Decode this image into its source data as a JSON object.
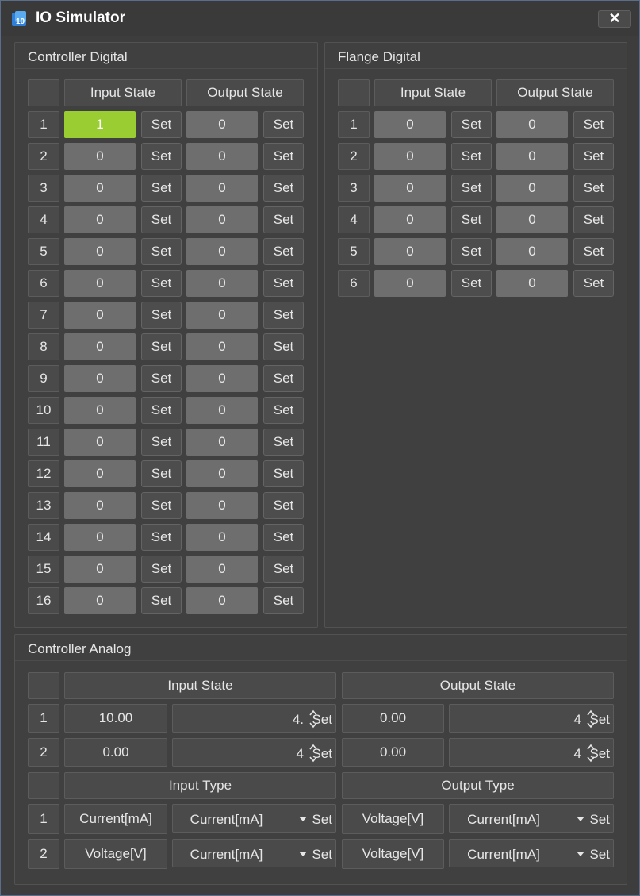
{
  "window": {
    "title": "IO Simulator",
    "close_label": "✕"
  },
  "controller_digital": {
    "title": "Controller Digital",
    "headers": {
      "input": "Input State",
      "output": "Output State"
    },
    "set_label": "Set",
    "rows": [
      {
        "idx": "1",
        "input": "1",
        "output": "0"
      },
      {
        "idx": "2",
        "input": "0",
        "output": "0"
      },
      {
        "idx": "3",
        "input": "0",
        "output": "0"
      },
      {
        "idx": "4",
        "input": "0",
        "output": "0"
      },
      {
        "idx": "5",
        "input": "0",
        "output": "0"
      },
      {
        "idx": "6",
        "input": "0",
        "output": "0"
      },
      {
        "idx": "7",
        "input": "0",
        "output": "0"
      },
      {
        "idx": "8",
        "input": "0",
        "output": "0"
      },
      {
        "idx": "9",
        "input": "0",
        "output": "0"
      },
      {
        "idx": "10",
        "input": "0",
        "output": "0"
      },
      {
        "idx": "11",
        "input": "0",
        "output": "0"
      },
      {
        "idx": "12",
        "input": "0",
        "output": "0"
      },
      {
        "idx": "13",
        "input": "0",
        "output": "0"
      },
      {
        "idx": "14",
        "input": "0",
        "output": "0"
      },
      {
        "idx": "15",
        "input": "0",
        "output": "0"
      },
      {
        "idx": "16",
        "input": "0",
        "output": "0"
      }
    ]
  },
  "flange_digital": {
    "title": "Flange Digital",
    "headers": {
      "input": "Input State",
      "output": "Output State"
    },
    "set_label": "Set",
    "rows": [
      {
        "idx": "1",
        "input": "0",
        "output": "0"
      },
      {
        "idx": "2",
        "input": "0",
        "output": "0"
      },
      {
        "idx": "3",
        "input": "0",
        "output": "0"
      },
      {
        "idx": "4",
        "input": "0",
        "output": "0"
      },
      {
        "idx": "5",
        "input": "0",
        "output": "0"
      },
      {
        "idx": "6",
        "input": "0",
        "output": "0"
      }
    ]
  },
  "controller_analog": {
    "title": "Controller Analog",
    "state_headers": {
      "input": "Input State",
      "output": "Output State"
    },
    "type_headers": {
      "input": "Input Type",
      "output": "Output Type"
    },
    "set_label": "Set",
    "state_rows": [
      {
        "idx": "1",
        "input_value": "10.00",
        "input_spin": "4.",
        "output_value": "0.00",
        "output_spin": "4"
      },
      {
        "idx": "2",
        "input_value": "0.00",
        "input_spin": "4",
        "output_value": "0.00",
        "output_spin": "4"
      }
    ],
    "type_rows": [
      {
        "idx": "1",
        "input_type": "Current[mA]",
        "input_select": "Current[mA]",
        "output_type": "Voltage[V]",
        "output_select": "Current[mA]"
      },
      {
        "idx": "2",
        "input_type": "Voltage[V]",
        "input_select": "Current[mA]",
        "output_type": "Voltage[V]",
        "output_select": "Current[mA]"
      }
    ]
  },
  "colors": {
    "active_input": "#9acd32",
    "value_bg": "#6e6e6e",
    "panel_bg": "#404040"
  },
  "icons": {
    "app": "app-icon",
    "close": "close-icon"
  }
}
